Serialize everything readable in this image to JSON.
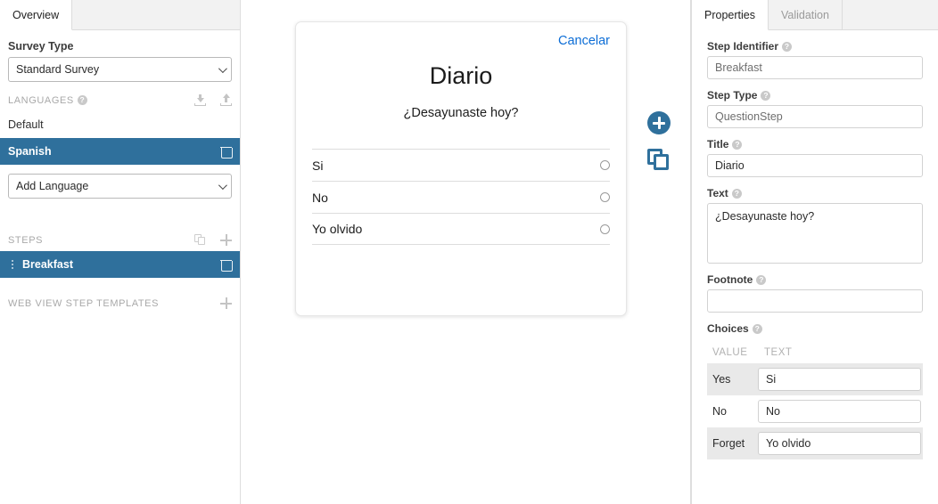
{
  "sidebar": {
    "tabs": [
      {
        "label": "Overview",
        "active": true
      }
    ],
    "survey_type_label": "Survey Type",
    "survey_type_value": "Standard Survey",
    "languages_section": "LANGUAGES",
    "languages": [
      {
        "label": "Default",
        "selected": false
      },
      {
        "label": "Spanish",
        "selected": true
      }
    ],
    "add_language_value": "Add Language",
    "steps_section": "STEPS",
    "steps": [
      {
        "label": "Breakfast",
        "selected": true
      }
    ],
    "templates_section": "WEB VIEW STEP TEMPLATES",
    "help_glyph": "?",
    "icons": {
      "download": "download-icon",
      "upload": "upload-icon",
      "copy": "copy-icon",
      "add": "plus-icon",
      "delete": "trash-icon",
      "drag": "drag-handle-icon"
    }
  },
  "preview": {
    "cancel_label": "Cancelar",
    "title": "Diario",
    "question": "¿Desayunaste hoy?",
    "choices": [
      {
        "text": "Si"
      },
      {
        "text": "No"
      },
      {
        "text": "Yo olvido"
      }
    ],
    "fab": {
      "add_name": "add-step-icon",
      "duplicate_name": "duplicate-step-icon"
    },
    "accent_color": "#2f709c",
    "link_color": "#0c6dd6"
  },
  "properties": {
    "tabs": [
      {
        "label": "Properties",
        "active": true
      },
      {
        "label": "Validation",
        "active": false
      }
    ],
    "fields": [
      {
        "label": "Step Identifier",
        "value": "Breakfast"
      },
      {
        "label": "Step Type",
        "value": "QuestionStep"
      },
      {
        "label": "Title",
        "value": "Diario"
      }
    ],
    "text_label": "Text",
    "text_value": "¿Desayunaste hoy?",
    "footnote_label": "Footnote",
    "footnote_value": "",
    "choices_label": "Choices",
    "choices_columns": {
      "value": "VALUE",
      "text": "TEXT"
    },
    "choices_rows": [
      {
        "value": "Yes",
        "text": "Si"
      },
      {
        "value": "No",
        "text": "No"
      },
      {
        "value": "Forget",
        "text": "Yo olvido"
      }
    ],
    "help_glyph": "?"
  }
}
